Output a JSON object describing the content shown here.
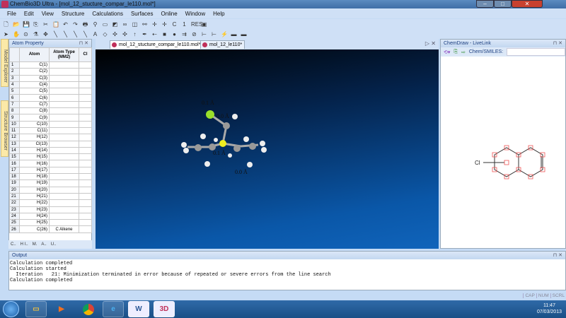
{
  "window": {
    "title": "ChemBio3D Ultra - [mol_12_stucture_compar_le110.mol*]",
    "min": "–",
    "max": "□",
    "close": "✕"
  },
  "menu": [
    "File",
    "Edit",
    "View",
    "Structure",
    "Calculations",
    "Surfaces",
    "Online",
    "Window",
    "Help"
  ],
  "toolbar1": [
    "🗋",
    "📂",
    "💾",
    "⎘",
    "✂",
    "📋",
    "↶",
    "↷",
    "🖶",
    "⚲",
    "▭",
    "◩",
    "∞",
    "◫",
    "⚯",
    "✛",
    "✛",
    "C",
    "1",
    "RES",
    "▣"
  ],
  "toolbar2": [
    "➤",
    "✋",
    "⊙",
    "⚗",
    "✥",
    "╲",
    "╲",
    "╲",
    "╲",
    "A",
    "◇",
    "✣",
    "✣",
    "↑",
    "✒",
    "⇠",
    "■",
    "●",
    "⇉",
    "⊘",
    "⊢",
    "⊢",
    "⚡",
    "▬",
    "▬"
  ],
  "atom_panel": {
    "title": "Atom Property",
    "headers": [
      "",
      "Atom",
      "Atom Type (MM2)",
      "Cl"
    ],
    "rows": [
      [
        "1",
        "C(1)",
        ""
      ],
      [
        "2",
        "C(2)",
        ""
      ],
      [
        "3",
        "C(3)",
        ""
      ],
      [
        "4",
        "C(4)",
        ""
      ],
      [
        "5",
        "C(5)",
        ""
      ],
      [
        "6",
        "C(6)",
        ""
      ],
      [
        "7",
        "C(7)",
        ""
      ],
      [
        "8",
        "C(8)",
        ""
      ],
      [
        "9",
        "C(9)",
        ""
      ],
      [
        "10",
        "C(10)",
        ""
      ],
      [
        "11",
        "C(11)",
        ""
      ],
      [
        "12",
        "H(12)",
        ""
      ],
      [
        "13",
        "Cl(13)",
        ""
      ],
      [
        "14",
        "H(14)",
        ""
      ],
      [
        "15",
        "H(15)",
        ""
      ],
      [
        "16",
        "H(16)",
        ""
      ],
      [
        "17",
        "H(17)",
        ""
      ],
      [
        "18",
        "H(18)",
        ""
      ],
      [
        "19",
        "H(19)",
        ""
      ],
      [
        "20",
        "H(20)",
        ""
      ],
      [
        "21",
        "H(21)",
        ""
      ],
      [
        "22",
        "H(22)",
        ""
      ],
      [
        "23",
        "H(23)",
        ""
      ],
      [
        "24",
        "H(24)",
        ""
      ],
      [
        "25",
        "H(25)",
        ""
      ],
      [
        "26",
        "C(26)",
        "C Alkene"
      ]
    ],
    "tabs": [
      "C..",
      "H I..",
      "M.",
      "A..",
      "U.."
    ]
  },
  "side_tabs": [
    "Model Explorer",
    "Structure Browser"
  ],
  "doc_tabs": [
    "mol_12_stucture_compar_le110.mol*",
    "mol_12_le110*"
  ],
  "viewport": {
    "labels": [
      "0.1 Å",
      "0.0 Å",
      "0.1 Å",
      "0.0 Å"
    ]
  },
  "livelink": {
    "title": "ChemDraw - LiveLink",
    "smiles_label": "Chem/SMILES:",
    "smiles_value": "",
    "atom_label": "Cl"
  },
  "output": {
    "title": "Output",
    "lines": [
      "Calculation completed",
      "Calculation started",
      "  Iteration   21: Minimization terminated in error because of repeated or severe errors from the line search",
      "Calculation completed"
    ]
  },
  "status": [
    "CAP",
    "NUM",
    "SCRL"
  ],
  "clock": {
    "time": "11:47",
    "date": "07/03/2013"
  }
}
